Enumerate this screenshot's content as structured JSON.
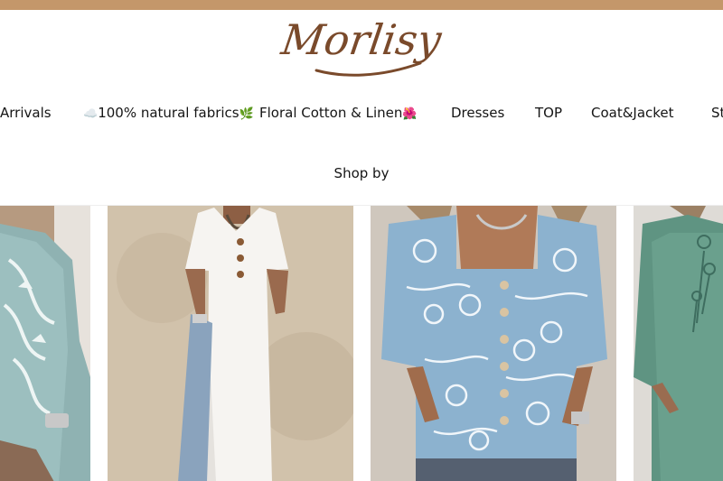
{
  "brand": {
    "name": "Morlisy"
  },
  "nav": {
    "items": [
      {
        "label": "Arrivals"
      },
      {
        "label": "100% natural fabrics"
      },
      {
        "label": "Floral Cotton & Linen"
      },
      {
        "label": "Dresses"
      },
      {
        "label": "TOP"
      },
      {
        "label": "Coat&Jacket"
      },
      {
        "label": "St"
      }
    ],
    "emoji": {
      "cloud": "☁️",
      "leaf": "🌿",
      "flower": "🌺"
    }
  },
  "section": {
    "shop_by": "Shop by"
  },
  "products": [
    {
      "name": "product-teal-embroidered-tunic"
    },
    {
      "name": "product-white-linen-dress"
    },
    {
      "name": "product-blue-floral-button-top"
    },
    {
      "name": "product-green-floral-tunic"
    }
  ],
  "colors": {
    "topbar": "#c4976a",
    "brand": "#7a4a2b"
  }
}
